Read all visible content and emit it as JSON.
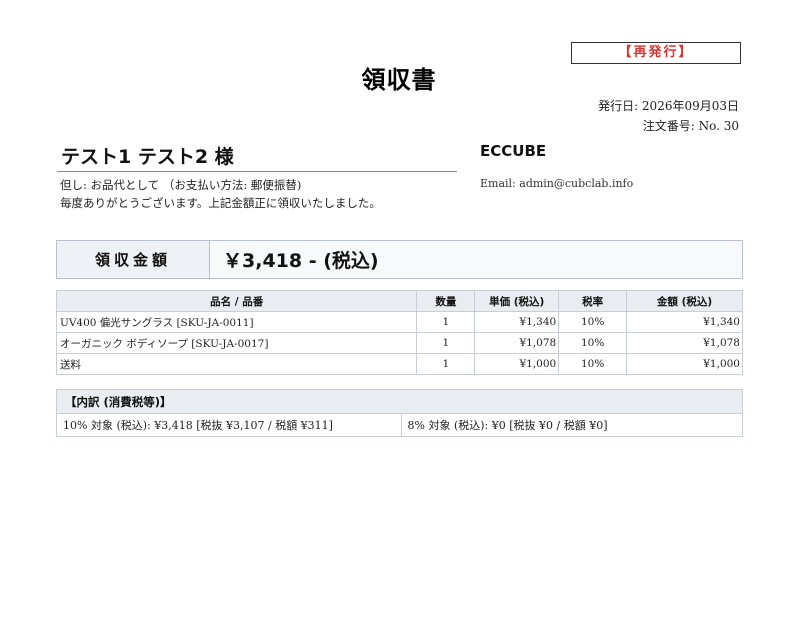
{
  "reissue_badge": "【再発行】",
  "title": "領収書",
  "issue_date": "発行日: 2026年09月03日",
  "order_no": "注文番号: No. 30",
  "customer_name": "テスト1 テスト2 様",
  "note_line1": "但し: お品代として （お支払い方法: 郵便振替)",
  "note_line2": "毎度ありがとうございます。上記金額正に領収いたしました。",
  "shop": {
    "name": "ECCUBE",
    "email": "Email: admin@cubclab.info"
  },
  "amount": {
    "label": "領収金額",
    "value": "￥3,418 - (税込)"
  },
  "items_table": {
    "headers": {
      "name": "品名 / 品番",
      "qty": "数量",
      "unit_price": "単価 (税込)",
      "tax_rate": "税率",
      "total": "金額 (税込)"
    },
    "rows": [
      {
        "name": "UV400 偏光サングラス [SKU-JA-0011]",
        "qty": "1",
        "unit_price": "¥1,340",
        "tax_rate": "10%",
        "total": "¥1,340"
      },
      {
        "name": "オーガニック ボディソープ [SKU-JA-0017]",
        "qty": "1",
        "unit_price": "¥1,078",
        "tax_rate": "10%",
        "total": "¥1,078"
      },
      {
        "name": "送料",
        "qty": "1",
        "unit_price": "¥1,000",
        "tax_rate": "10%",
        "total": "¥1,000"
      }
    ]
  },
  "tax_breakdown": {
    "header": "【内訳 (消費税等)】",
    "rate10": "10% 対象 (税込): ¥3,418 [税抜 ¥3,107 / 税額 ¥311]",
    "rate8": "8% 対象 (税込): ¥0 [税抜 ¥0 / 税額 ¥0]"
  }
}
